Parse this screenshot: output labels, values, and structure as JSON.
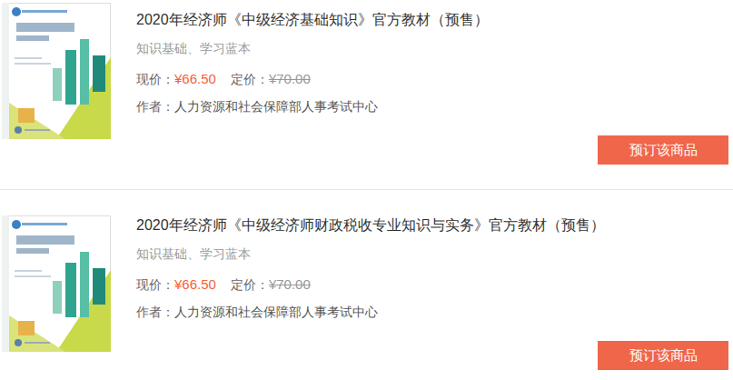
{
  "products": [
    {
      "title": "2020年经济师《中级经济基础知识》官方教材（预售）",
      "subtitle": "知识基础、学习蓝本",
      "price_label": "现价：",
      "price": "¥66.50",
      "list_price_label": "定价：",
      "list_price": "¥70.00",
      "author_label": "作者：",
      "author": "人力资源和社会保障部人事考试中心",
      "button": "预订该商品"
    },
    {
      "title": "2020年经济师《中级经济师财政税收专业知识与实务》官方教材（预售）",
      "subtitle": "知识基础、学习蓝本",
      "price_label": "现价：",
      "price": "¥66.50",
      "list_price_label": "定价：",
      "list_price": "¥70.00",
      "author_label": "作者：",
      "author": "人力资源和社会保障部人事考试中心",
      "button": "预订该商品"
    }
  ]
}
